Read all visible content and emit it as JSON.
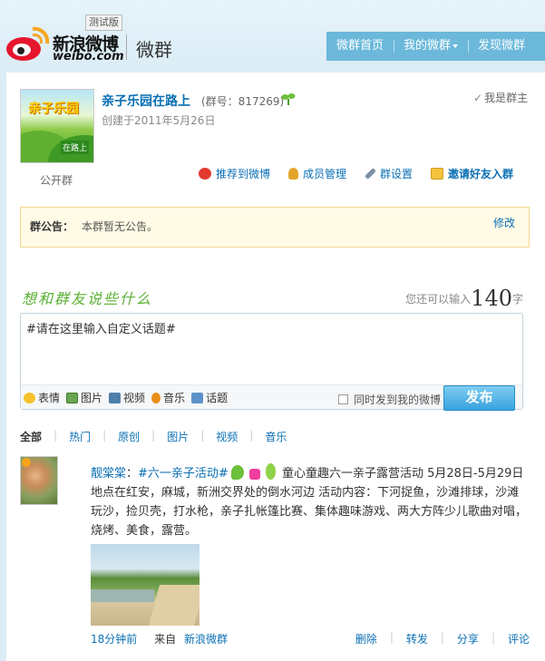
{
  "header": {
    "logo_cn": "新浪微博",
    "logo_en": "weibo.com",
    "badge": "测试版",
    "product": "微群",
    "nav": [
      "微群首页",
      "我的微群",
      "发现微群"
    ]
  },
  "group": {
    "avatar_title": "亲子乐园",
    "avatar_badge": "在路上",
    "type": "公开群",
    "name": "亲子乐园在路上",
    "id_text": "(群号：817269)",
    "created": "创建于2011年5月26日",
    "member_status": "我是群主"
  },
  "actions": [
    "推荐到微博",
    "成员管理",
    "群设置",
    "邀请好友入群"
  ],
  "notice": {
    "label": "群公告：",
    "text": "本群暂无公告。",
    "edit": "修改"
  },
  "composer": {
    "prompt": "想和群友说些什么",
    "counter_prefix": "您还可以输入",
    "counter_num": "140",
    "counter_suffix": "字",
    "input_value": "#请在这里输入自定义话题#",
    "tools": [
      "表情",
      "图片",
      "视频",
      "音乐",
      "话题"
    ],
    "sync_label": "同时发到我的微博",
    "publish": "发布"
  },
  "tabs": [
    "全部",
    "热门",
    "原创",
    "图片",
    "视频",
    "音乐"
  ],
  "post": {
    "author": "靓棠棠",
    "topic": "#六一亲子活动#",
    "text": "童心童趣六一亲子露营活动  5月28日-5月29日  地点在红安，麻城，新洲交界处的倒水河边  活动内容：下河捉鱼，沙滩排球，沙滩玩沙，捡贝壳，打水枪，亲子扎帐篷比赛、集体趣味游戏、两大方阵少儿歌曲对唱，烧烤、美食，露营。",
    "time": "18分钟前",
    "from_label": "来自",
    "source": "新浪微群",
    "ops": [
      "删除",
      "转发",
      "分享",
      "评论"
    ]
  },
  "colors": {
    "link": "#0a6fb4",
    "nav_bg": "#6bb8da",
    "notice_bg": "#fffbe6",
    "publish": "#38a2df",
    "prompt": "#58b030"
  }
}
